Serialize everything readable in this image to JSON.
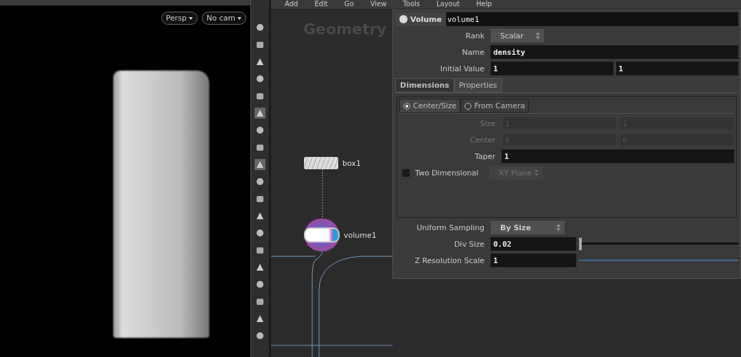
{
  "viewport": {
    "view_menus": [
      {
        "label": "Persp"
      },
      {
        "label": "No cam"
      }
    ]
  },
  "menu": [
    "Add",
    "Edit",
    "Go",
    "View",
    "Tools",
    "Layout",
    "Help"
  ],
  "network": {
    "title": "Geometry",
    "nodes": [
      {
        "label": "box1",
        "kind": "box"
      },
      {
        "label": "volume1",
        "kind": "volume"
      }
    ]
  },
  "params": {
    "node_type": "Volume",
    "node_name": "volume1",
    "rank": {
      "label": "Rank",
      "value": "Scalar"
    },
    "name": {
      "label": "Name",
      "value": "density"
    },
    "initial_value": {
      "label": "Initial Value",
      "values": [
        "1",
        "1"
      ]
    },
    "tabs": [
      {
        "label": "Dimensions",
        "selected": true
      },
      {
        "label": "Properties",
        "selected": false
      }
    ],
    "modes": [
      {
        "label": "Center/Size",
        "selected": true
      },
      {
        "label": "From Camera",
        "selected": false
      }
    ],
    "fields": [
      {
        "label": "Size",
        "values": [
          "1",
          "1"
        ],
        "disabled": true
      },
      {
        "label": "Center",
        "values": [
          "0",
          "0"
        ],
        "disabled": true
      },
      {
        "label": "Taper",
        "values": [
          "1"
        ],
        "disabled": false
      }
    ],
    "two_dimensional": {
      "label": "Two Dimensional",
      "checked": false,
      "plane": "XY Plane"
    },
    "uniform_sampling": {
      "label": "Uniform Sampling",
      "value": "By Size"
    },
    "div_size": {
      "label": "Div Size",
      "value": "0.02",
      "level": 0
    },
    "z_res": {
      "label": "Z Resolution Scale",
      "value": "1"
    }
  }
}
